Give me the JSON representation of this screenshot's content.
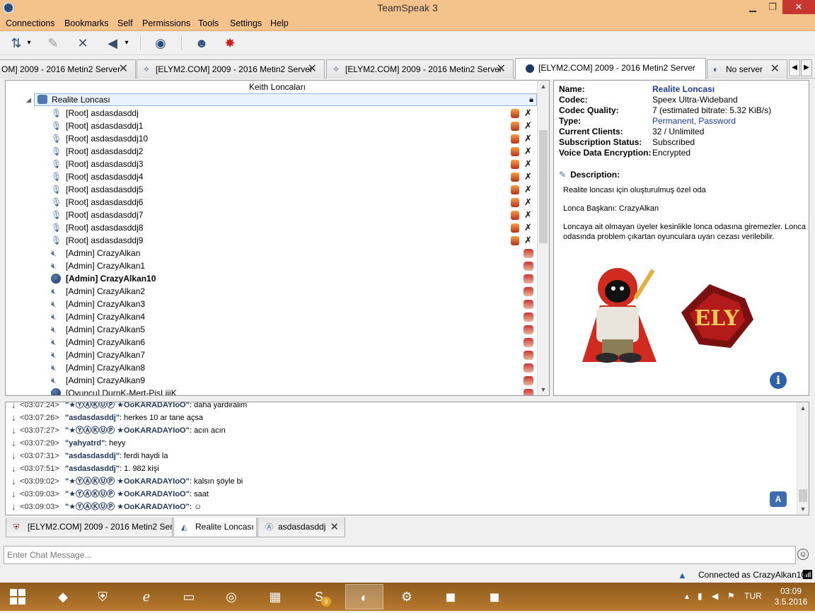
{
  "window": {
    "title": "TeamSpeak 3",
    "min": "▁",
    "max": "❐",
    "close": "✕"
  },
  "menu": [
    "Connections",
    "Bookmarks",
    "Self",
    "Permissions",
    "Tools",
    "Settings",
    "Help"
  ],
  "toolbar_icons": [
    "connect-disconnect-icon",
    "away-icon",
    "mute-microphone-icon",
    "mute-speakers-icon",
    "subscribe-icon",
    "contacts-icon",
    "identity-icon"
  ],
  "tabs": [
    {
      "label": "OM] 2009 - 2016 Metin2 Server",
      "close": "✕"
    },
    {
      "label": "[ELYM2.COM] 2009 - 2016 Metin2 Server",
      "close": "✕"
    },
    {
      "label": "[ELYM2.COM] 2009 - 2016 Metin2 Server",
      "close": "✕"
    },
    {
      "label": "[ELYM2.COM] 2009 - 2016 Metin2 Server",
      "close": "✕"
    },
    {
      "label": "No server",
      "close": "✕"
    }
  ],
  "tree": {
    "root": "Keith Loncaları",
    "channel": "Realite Loncası",
    "users": [
      {
        "label": "[Root] asdasdasddj",
        "group": "root"
      },
      {
        "label": "[Root] asdasdasddj1",
        "group": "root"
      },
      {
        "label": "[Root] asdasdasddj10",
        "group": "root"
      },
      {
        "label": "[Root] asdasdasddj2",
        "group": "root"
      },
      {
        "label": "[Root] asdasdasddj3",
        "group": "root"
      },
      {
        "label": "[Root] asdasdasddj4",
        "group": "root"
      },
      {
        "label": "[Root] asdasdasddj5",
        "group": "root"
      },
      {
        "label": "[Root] asdasdasddj6",
        "group": "root"
      },
      {
        "label": "[Root] asdasdasddj7",
        "group": "root"
      },
      {
        "label": "[Root] asdasdasddj8",
        "group": "root"
      },
      {
        "label": "[Root] asdasdasddj9",
        "group": "root"
      },
      {
        "label": "[Admin] CrazyAlkan",
        "group": "admin"
      },
      {
        "label": "[Admin] CrazyAlkan1",
        "group": "admin"
      },
      {
        "label": "[Admin] CrazyAlkan10",
        "group": "admin",
        "bold": true
      },
      {
        "label": "[Admin] CrazyAlkan2",
        "group": "admin"
      },
      {
        "label": "[Admin] CrazyAlkan3",
        "group": "admin"
      },
      {
        "label": "[Admin] CrazyAlkan4",
        "group": "admin"
      },
      {
        "label": "[Admin] CrazyAlkan5",
        "group": "admin"
      },
      {
        "label": "[Admin] CrazyAlkan6",
        "group": "admin"
      },
      {
        "label": "[Admin] CrazyAlkan7",
        "group": "admin"
      },
      {
        "label": "[Admin] CrazyAlkan8",
        "group": "admin"
      },
      {
        "label": "[Admin] CrazyAlkan9",
        "group": "admin"
      },
      {
        "label": "[Oyuncu] DurnK-Mert-PisLiiiK",
        "group": "player"
      }
    ]
  },
  "info": {
    "rows": [
      {
        "key": "Name:",
        "value": "Realite Loncası"
      },
      {
        "key": "Codec:",
        "value": "Speex Ultra-Wideband"
      },
      {
        "key": "Codec Quality:",
        "value": "7 (estimated bitrate: 5.32 KiB/s)"
      },
      {
        "key": "Type:",
        "value": "Permanent, Password"
      },
      {
        "key": "Current Clients:",
        "value": "32 / Unlimited"
      },
      {
        "key": "Subscription Status:",
        "value": "Subscribed"
      },
      {
        "key": "Voice Data Encryption:",
        "value": "Encrypted"
      }
    ],
    "description_header": "Description:",
    "desc1": "Realite loncası için oluşturulmuş özel oda",
    "desc2": "Lonca Başkanı:  CrazyAlkan",
    "desc3": "Loncaya ait olmayan üyeler kesinlikle lonca odasına giremezler. Lonca odasında problem çıkartan oyunculara uyarı cezası verilebilir.",
    "logo_text": "ELY",
    "info_button": "i"
  },
  "chat": [
    {
      "time": "<03:07:24>",
      "nick": "\"★ⓎⒶⓀⓊⓅ ★OoKARADAYIoO\"",
      "msg": ": daha yardiralim"
    },
    {
      "time": "<03:07:26>",
      "nick": "\"asdasdasddj\"",
      "msg": ": herkes 10 ar tane açsa"
    },
    {
      "time": "<03:07:27>",
      "nick": "\"★ⓎⒶⓀⓊⓅ ★OoKARADAYIoO\"",
      "msg": ": acın acın"
    },
    {
      "time": "<03:07:29>",
      "nick": "\"yahyatrd\"",
      "msg": ": heyy"
    },
    {
      "time": "<03:07:31>",
      "nick": "\"asdasdasddj\"",
      "msg": ": ferdi haydi la"
    },
    {
      "time": "<03:07:51>",
      "nick": "\"asdasdasddj\"",
      "msg": ": 1. 982 kişi"
    },
    {
      "time": "<03:09:02>",
      "nick": "\"★ⓎⒶⓀⓊⓅ ★OoKARADAYIoO\"",
      "msg": ": kalsın şöyle bi"
    },
    {
      "time": "<03:09:03>",
      "nick": "\"★ⓎⒶⓀⓊⓅ ★OoKARADAYIoO\"",
      "msg": ": saat"
    },
    {
      "time": "<03:09:03>",
      "nick": "\"★ⓎⒶⓀⓊⓅ ★OoKARADAYIoO\"",
      "msg": ": ☺"
    }
  ],
  "chat_tabs": [
    {
      "label": "[ELYM2.COM] 2009 - 2016 Metin2 Server"
    },
    {
      "label": "Realite Loncası"
    },
    {
      "label": "asdasdasddj",
      "close": "✕"
    }
  ],
  "chat_input": {
    "placeholder": "Enter Chat Message..."
  },
  "status": {
    "text": "Connected as CrazyAlkan10"
  },
  "taskbar": {
    "lang": "TUR",
    "time": "03:09",
    "date": "3.5.2016",
    "badge": "9"
  }
}
